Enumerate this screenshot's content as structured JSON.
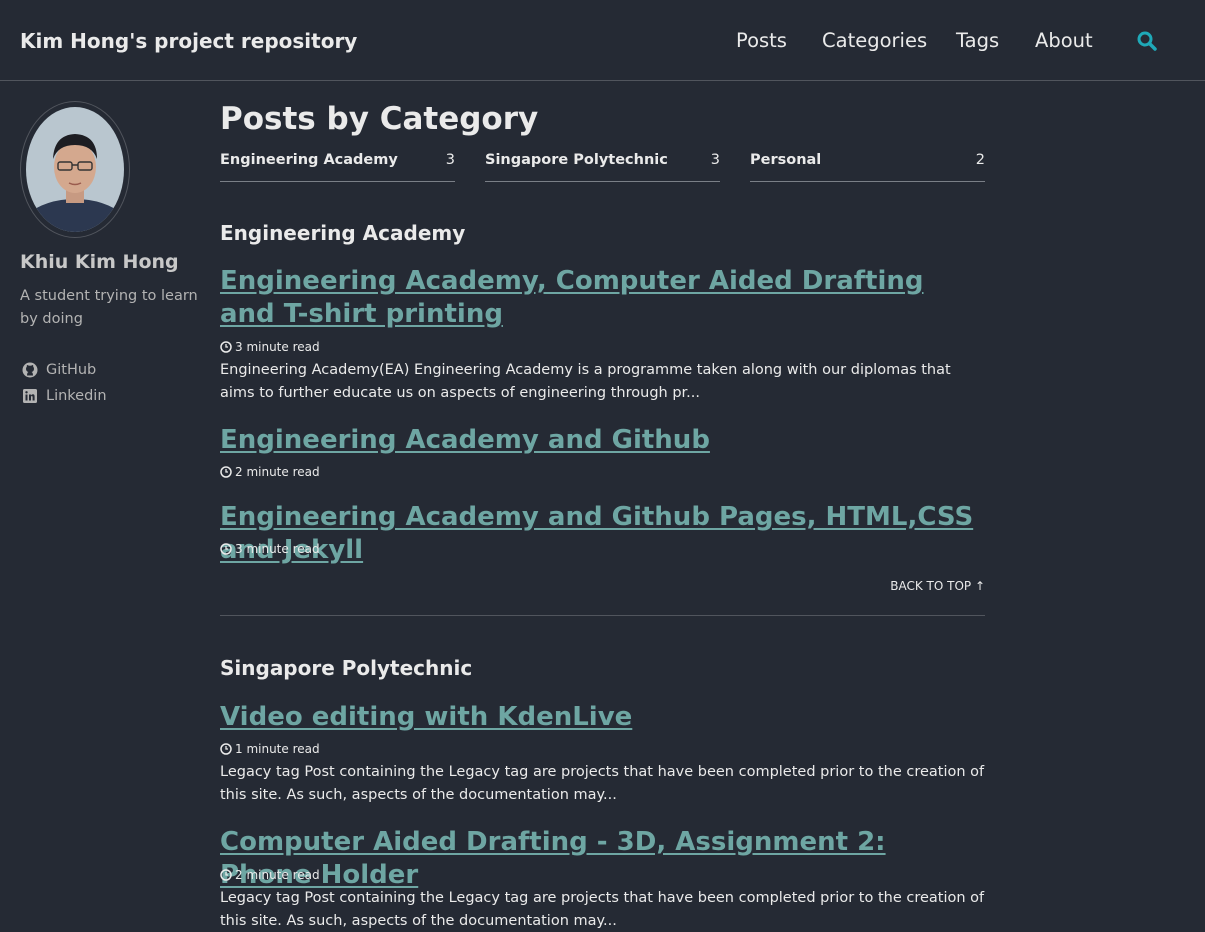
{
  "site": {
    "title": "Kim Hong's project repository"
  },
  "nav": {
    "posts": "Posts",
    "categories": "Categories",
    "tags": "Tags",
    "about": "About"
  },
  "colors": {
    "background": "#252a34",
    "link": "#6ea6a3",
    "search_icon": "#1fa9b8"
  },
  "sidebar": {
    "name": "Khiu Kim Hong",
    "bio": "A student trying to learn by doing",
    "links": [
      {
        "label": "GitHub",
        "icon": "github-icon"
      },
      {
        "label": "Linkedin",
        "icon": "linkedin-icon"
      }
    ]
  },
  "page": {
    "title": "Posts by Category",
    "category_index": [
      {
        "name": "Engineering Academy",
        "count": "3"
      },
      {
        "name": "Singapore Polytechnic",
        "count": "3"
      },
      {
        "name": "Personal",
        "count": "2"
      }
    ],
    "back_to_top": "BACK TO TOP ↑",
    "sections": [
      {
        "title": "Engineering Academy",
        "posts": [
          {
            "title": "Engineering Academy, Computer Aided Drafting and T-shirt printing",
            "read_time": "3 minute read",
            "excerpt": "Engineering Academy(EA) Engineering Academy is a programme taken along with our diplomas that aims to further educate us on aspects of engineering through pr..."
          },
          {
            "title": "Engineering Academy and Github",
            "read_time": "2 minute read",
            "excerpt": ""
          },
          {
            "title": "Engineering Academy and Github Pages, HTML,CSS and Jekyll",
            "read_time": "3 minute read",
            "excerpt": ""
          }
        ]
      },
      {
        "title": "Singapore Polytechnic",
        "posts": [
          {
            "title": "Video editing with KdenLive",
            "read_time": "1 minute read",
            "excerpt": "Legacy tag Post containing the Legacy tag are projects that have been completed prior to the creation of this site. As such, aspects of the documentation may..."
          },
          {
            "title": "Computer Aided Drafting - 3D, Assignment 2: Phone Holder",
            "read_time": "2 minute read",
            "excerpt": "Legacy tag Post containing the Legacy tag are projects that have been completed prior to the creation of this site. As such, aspects of the documentation may..."
          }
        ]
      }
    ]
  }
}
